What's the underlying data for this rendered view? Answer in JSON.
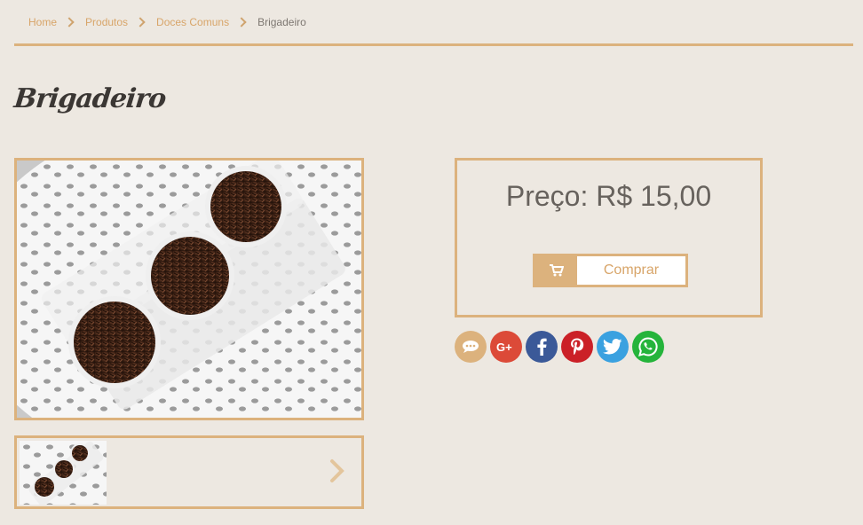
{
  "breadcrumb": {
    "items": [
      {
        "label": "Home"
      },
      {
        "label": "Produtos"
      },
      {
        "label": "Doces Comuns"
      },
      {
        "label": "Brigadeiro"
      }
    ]
  },
  "product": {
    "title": "Brigadeiro",
    "price_text": "Preço: R$ 15,00",
    "buy_label": "Comprar"
  },
  "icons": {
    "breadcrumb_separator": "chevron-right-icon",
    "cart": "cart-icon",
    "thumb_next": "chevron-right-icon"
  },
  "share": [
    {
      "network": "comment",
      "icon": "comment-icon",
      "color": "#dcb27d"
    },
    {
      "network": "google-plus",
      "icon": "google-plus-icon",
      "color": "#dc4a38"
    },
    {
      "network": "facebook",
      "icon": "facebook-icon",
      "color": "#3b5998"
    },
    {
      "network": "pinterest",
      "icon": "pinterest-icon",
      "color": "#cb2027"
    },
    {
      "network": "twitter",
      "icon": "twitter-icon",
      "color": "#3aa1e0"
    },
    {
      "network": "whatsapp",
      "icon": "whatsapp-icon",
      "color": "#25b43b"
    }
  ],
  "colors": {
    "accent": "#dcb27d",
    "background": "#ede8e1",
    "link": "#d8a569"
  }
}
